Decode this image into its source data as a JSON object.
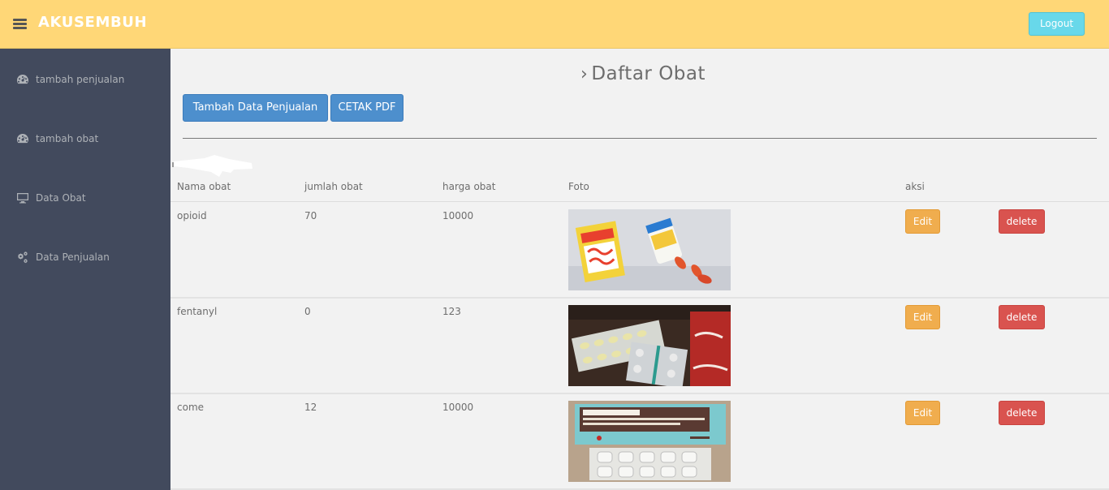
{
  "app": {
    "title": "AKUSEMBUH"
  },
  "header": {
    "logout_label": "Logout"
  },
  "sidebar": {
    "items": [
      {
        "label": "tambah penjualan",
        "icon": "dashboard-icon"
      },
      {
        "label": "tambah obat",
        "icon": "dashboard-icon"
      },
      {
        "label": "Data Obat",
        "icon": "desktop-icon"
      },
      {
        "label": "Data Penjualan",
        "icon": "cogs-icon"
      }
    ]
  },
  "main": {
    "title": "Daftar Obat",
    "buttons": {
      "add_label": "Tambah Data Penjualan",
      "pdf_label": "CETAK PDF"
    },
    "table": {
      "columns": [
        "Nama obat",
        "jumlah obat",
        "harga obat",
        "Foto",
        "aksi"
      ],
      "rows": [
        {
          "name": "opioid",
          "qty": "70",
          "price": "10000",
          "photo": "capsule-box-photo"
        },
        {
          "name": "fentanyl",
          "qty": "0",
          "price": "123",
          "photo": "pill-strips-photo"
        },
        {
          "name": "come",
          "qty": "12",
          "price": "10000",
          "photo": "neuralgin-box-photo"
        }
      ],
      "edit_label": "Edit",
      "delete_label": "delete"
    }
  },
  "colors": {
    "topbar": "#ffd777",
    "sidebar": "#424a5d",
    "primary": "#4d8fcd",
    "warning": "#f0ad4e",
    "danger": "#d9534f",
    "info": "#68d8ea"
  }
}
